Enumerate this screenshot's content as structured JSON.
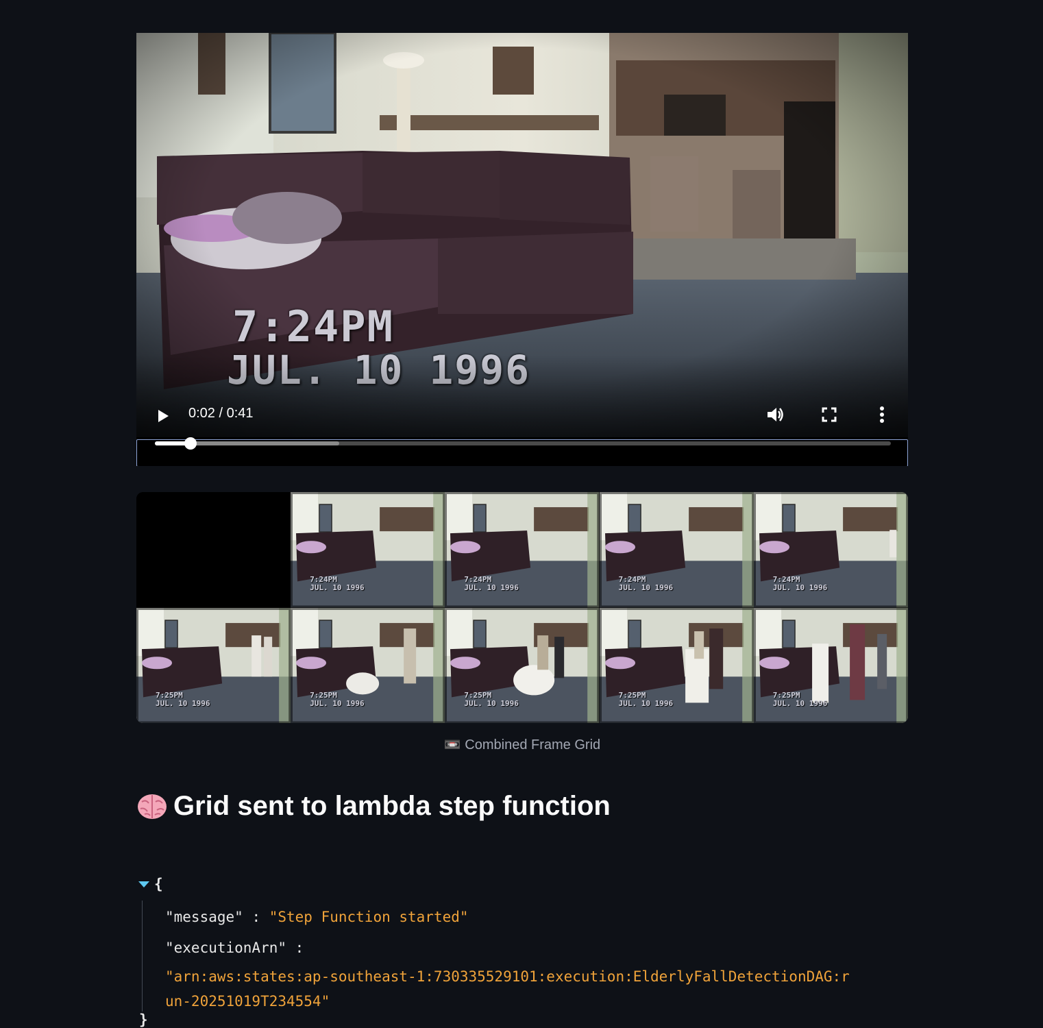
{
  "video": {
    "overlay_time": "7:24PM",
    "overlay_date": "JUL. 10 1996",
    "time_display": "0:02 / 0:41",
    "progress": 0.0488,
    "buffered": 0.25,
    "controls": {
      "play_icon": "play-icon",
      "volume_icon": "volume-icon",
      "fullscreen_icon": "fullscreen-icon",
      "more_icon": "more-vertical-icon"
    }
  },
  "frame_grid": {
    "frames": [
      {
        "time": "",
        "date": "",
        "blank": true
      },
      {
        "time": "7:24PM",
        "date": "JUL. 10 1996"
      },
      {
        "time": "7:24PM",
        "date": "JUL. 10 1996"
      },
      {
        "time": "7:24PM",
        "date": "JUL. 10 1996"
      },
      {
        "time": "7:24PM",
        "date": "JUL. 10 1996"
      },
      {
        "time": "7:25PM",
        "date": "JUL. 10 1996"
      },
      {
        "time": "7:25PM",
        "date": "JUL. 10 1996"
      },
      {
        "time": "7:25PM",
        "date": "JUL. 10 1996"
      },
      {
        "time": "7:25PM",
        "date": "JUL. 10 1996"
      },
      {
        "time": "7:25PM",
        "date": "JUL. 10 1996"
      }
    ],
    "caption": "📼 Combined Frame Grid"
  },
  "section": {
    "icon": "brain-icon",
    "title": "Grid sent to lambda step function"
  },
  "json_view": {
    "open_brace": "{",
    "close_brace": "}",
    "message_key": "\"message\"",
    "message_value": "\"Step Function started\"",
    "arn_key": "\"executionArn\"",
    "arn_value": "\"arn:aws:states:ap-southeast-1:730335529101:execution:ElderlyFallDetectionDAG:run-20251019T234554\"",
    "separator": " : "
  },
  "colors": {
    "background": "#0e1117",
    "json_string": "#f0a33a",
    "toggle": "#5ec8f0",
    "seek_border": "#8ea4d6"
  }
}
